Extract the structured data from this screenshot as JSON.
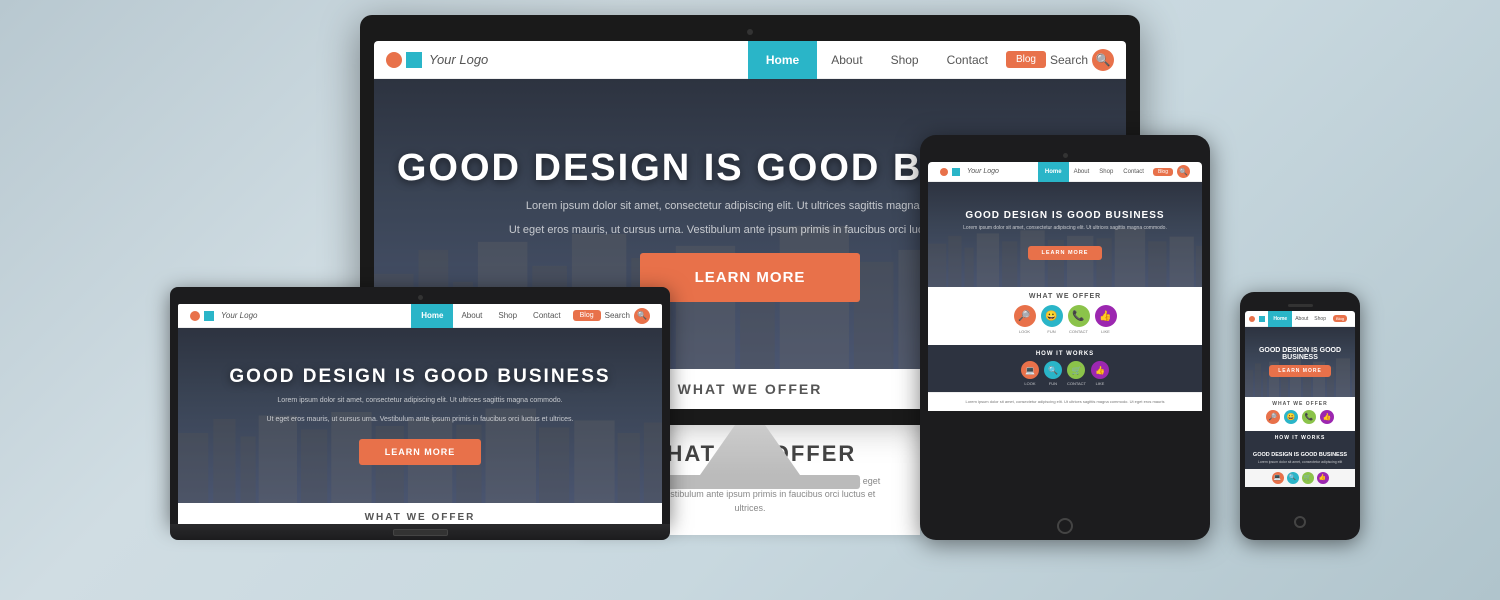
{
  "brand": {
    "logo_text": "Your Logo",
    "logo_circle_color": "#e8714a",
    "logo_square_color": "#2ab5c8"
  },
  "nav": {
    "home": "Home",
    "about": "About",
    "shop": "Shop",
    "contact": "Contact",
    "blog": "Blog",
    "search": "Search"
  },
  "hero": {
    "title": "GOOD DESIGN IS GOOD BUSINESS",
    "subtitle_line1": "Lorem ipsum dolor sit amet, consectetur adipiscing elit. Ut ultrices sagittis magna commodo.",
    "subtitle_line2": "Ut eget eros mauris, ut cursus urna. Vestibulum ante ipsum primis in faucibus orci luctus et ultrices.",
    "cta_button": "LEARN MORE"
  },
  "section_what_we_offer": {
    "title": "WHAT WE OFFER",
    "description": "ctetur adipiscing elit. Ut ultrices sagittis magna commodo. Ut eget eros ma Vestibulum ante ipsum primis in faucibus orci luctus et ultrices."
  },
  "section_how_it_works": {
    "title": "HOW IT WORKS"
  },
  "icons": {
    "look": {
      "label": "LOOK",
      "color": "#e8714a"
    },
    "fun": {
      "label": "FUN",
      "color": "#2ab5c8"
    },
    "contact": {
      "label": "CONTACT",
      "color": "#8bc34a"
    },
    "like": {
      "label": "LIKE",
      "color": "#9c27b0"
    }
  },
  "colors": {
    "accent_orange": "#e8714a",
    "accent_teal": "#2ab5c8",
    "nav_home_bg": "#2ab5c8",
    "hero_dark": "#2d3340",
    "background_gradient_start": "#b8c8d0",
    "background_gradient_end": "#c8d8df"
  }
}
